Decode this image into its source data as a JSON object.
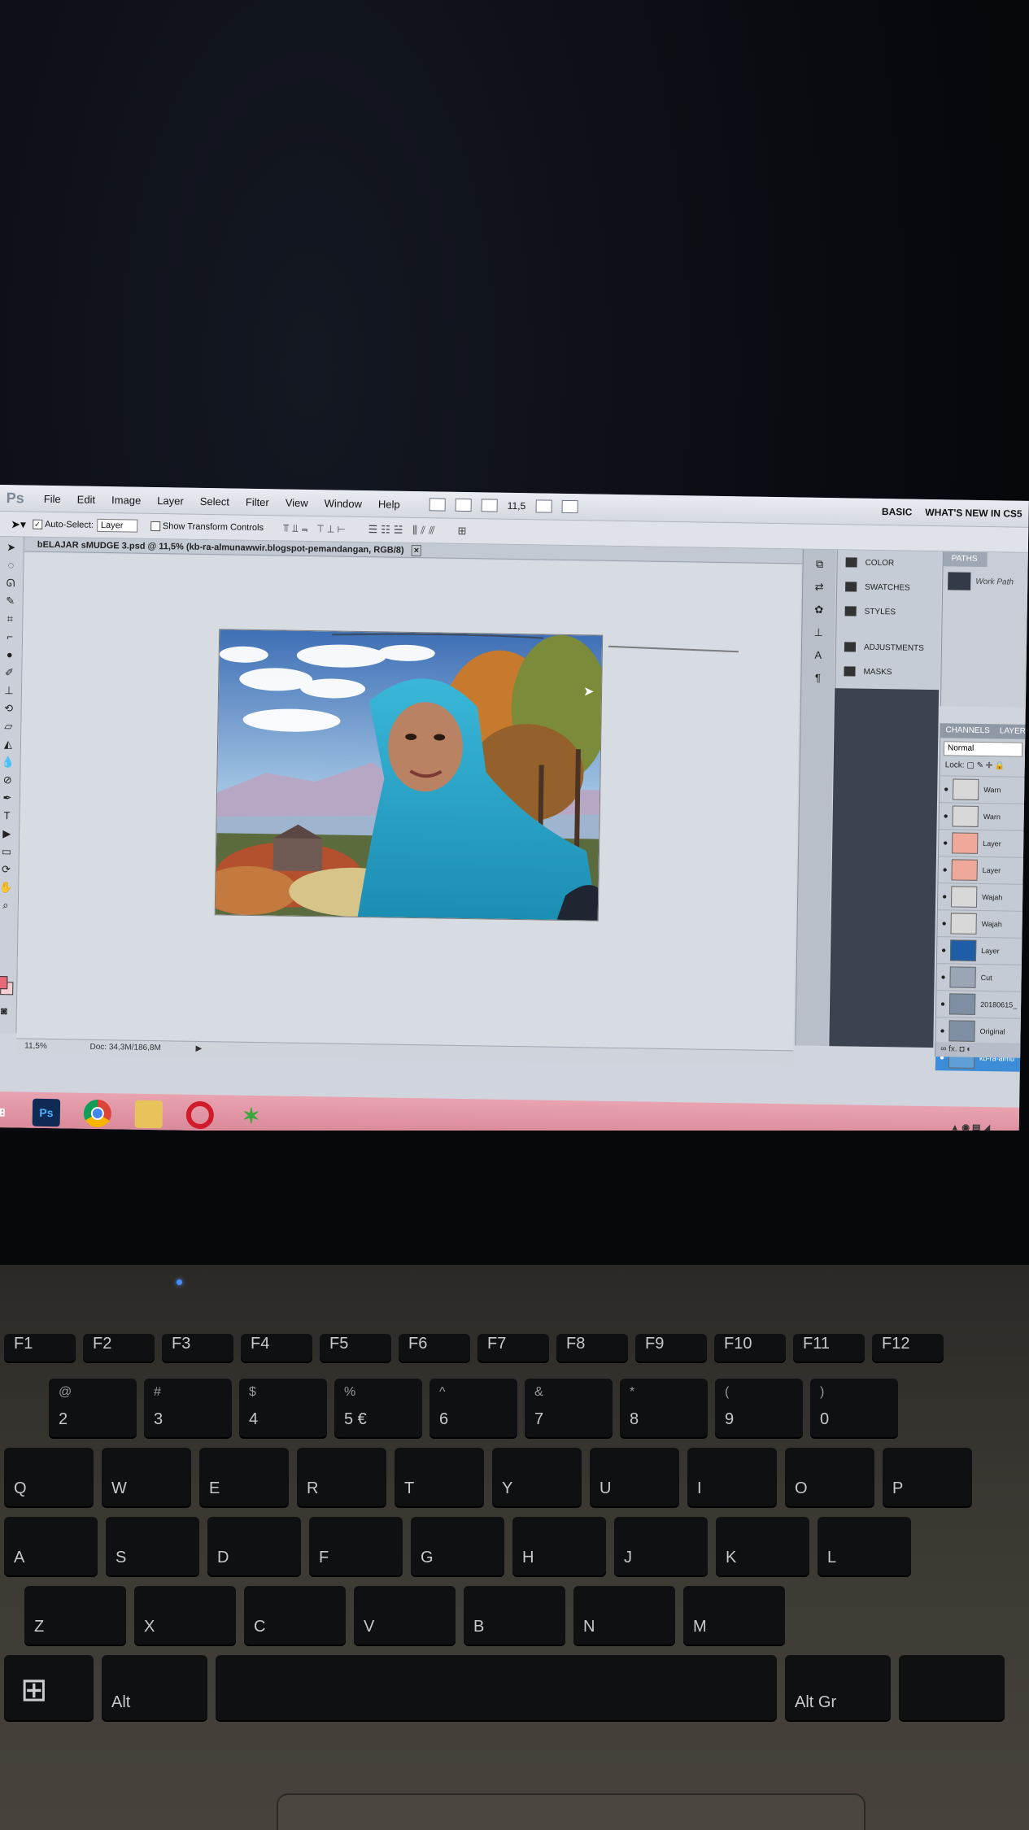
{
  "app": {
    "logo": "Ps",
    "menu": [
      "File",
      "Edit",
      "Image",
      "Layer",
      "Select",
      "Filter",
      "View",
      "Window",
      "Help"
    ],
    "zoom_display": "11,5",
    "workspaces": [
      "BASIC",
      "WHAT'S NEW IN CS5"
    ]
  },
  "options_bar": {
    "auto_select_label": "Auto-Select:",
    "auto_select_value": "Layer",
    "show_transform_label": "Show Transform Controls"
  },
  "document": {
    "tab_title": "bELAJAR sMUDGE 3.psd @ 11,5% (kb-ra-almunawwir.blogspot-pemandangan, RGB/8)",
    "tab_close": "×"
  },
  "status_bar": {
    "zoom": "11,5%",
    "doc_size": "Doc: 34,3M/186,8M"
  },
  "dock_panels": [
    "COLOR",
    "SWATCHES",
    "STYLES",
    "ADJUSTMENTS",
    "MASKS"
  ],
  "paths_panel": {
    "tab": "PATHS",
    "item": "Work Path"
  },
  "layers_panel": {
    "tabs": [
      "CHANNELS",
      "LAYER"
    ],
    "blend_mode": "Normal",
    "lock_label": "Lock:",
    "layers": [
      {
        "name": "Warn",
        "thumb": "#d8d8d8"
      },
      {
        "name": "Warn",
        "thumb": "#d8d8d8"
      },
      {
        "name": "Layer",
        "thumb": "#f0a89a"
      },
      {
        "name": "Layer",
        "thumb": "#f0a89a"
      },
      {
        "name": "Wajah",
        "thumb": "#d8d8d8"
      },
      {
        "name": "Wajah",
        "thumb": "#d8d8d8"
      },
      {
        "name": "Layer",
        "thumb": "#1f5ea6"
      },
      {
        "name": "Cut",
        "thumb": "#9aa6b5"
      },
      {
        "name": "20180615_",
        "thumb": "#7f8fa3"
      },
      {
        "name": "Original",
        "thumb": "#7f8fa3"
      },
      {
        "name": "kb-ra-almu",
        "thumb": "#5f9fd6"
      }
    ],
    "footer": "fx."
  },
  "taskbar": {
    "apps": [
      "Ps"
    ]
  },
  "keyboard": {
    "row_fn": [
      "F1",
      "F2",
      "F3",
      "F4",
      "F5",
      "F6",
      "F7",
      "F8",
      "F9",
      "F10",
      "F11",
      "F12"
    ],
    "row_num": [
      {
        "top": "@",
        "main": "2"
      },
      {
        "top": "#",
        "main": "3"
      },
      {
        "top": "$",
        "main": "4"
      },
      {
        "top": "%",
        "main": "5 €"
      },
      {
        "top": "^",
        "main": "6"
      },
      {
        "top": "&",
        "main": "7"
      },
      {
        "top": "*",
        "main": "8"
      },
      {
        "top": "(",
        "main": "9"
      },
      {
        "top": ")",
        "main": "0"
      }
    ],
    "row_q": [
      "Q",
      "W",
      "E",
      "R",
      "T",
      "Y",
      "U",
      "I",
      "O",
      "P"
    ],
    "row_a": [
      "A",
      "S",
      "D",
      "F",
      "G",
      "H",
      "J",
      "K",
      "L"
    ],
    "row_z": [
      "Z",
      "X",
      "C",
      "V",
      "B",
      "N",
      "M"
    ],
    "alt": "Alt",
    "altgr": "Alt Gr"
  }
}
